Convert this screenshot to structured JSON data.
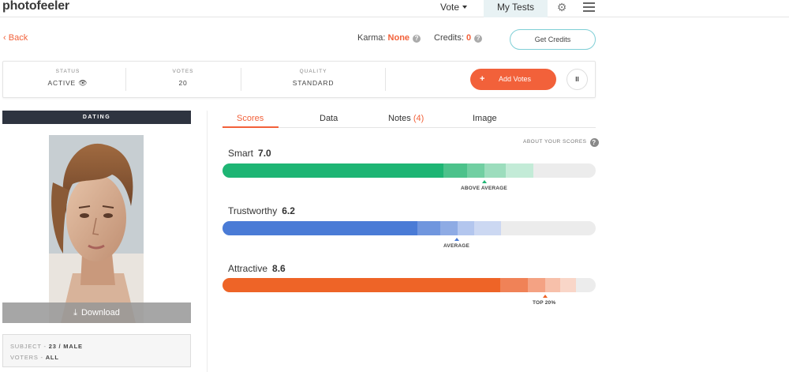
{
  "nav": {
    "logo": "photofeeler",
    "vote": "Vote",
    "my_tests": "My Tests"
  },
  "header": {
    "back": "Back",
    "karma_label": "Karma:",
    "karma_value": "None",
    "credits_label": "Credits:",
    "credits_value": "0",
    "get_credits": "Get Credits"
  },
  "status_card": {
    "status_label": "STATUS",
    "status_value": "ACTIVE",
    "votes_label": "VOTES",
    "votes_value": "20",
    "quality_label": "QUALITY",
    "quality_value": "STANDARD",
    "add_votes": "Add Votes",
    "add_votes_icon": "+",
    "pause_icon": "II"
  },
  "left": {
    "category": "DATING",
    "download": "Download",
    "subject_label": "SUBJECT -",
    "subject_value": "23 / MALE",
    "voters_label": "VOTERS -",
    "voters_value": "ALL"
  },
  "tabs": {
    "scores": "Scores",
    "data": "Data",
    "notes": "Notes",
    "notes_count": "(4)",
    "image": "Image"
  },
  "about_scores": "ABOUT YOUR SCORES",
  "scores": [
    {
      "name": "Smart",
      "value": "7.0",
      "band": "ABOVE AVERAGE",
      "color": "#1eb574"
    },
    {
      "name": "Trustworthy",
      "value": "6.2",
      "band": "AVERAGE",
      "color": "#4a7bd6"
    },
    {
      "name": "Attractive",
      "value": "8.6",
      "band": "TOP 20%",
      "color": "#ee6427"
    }
  ]
}
